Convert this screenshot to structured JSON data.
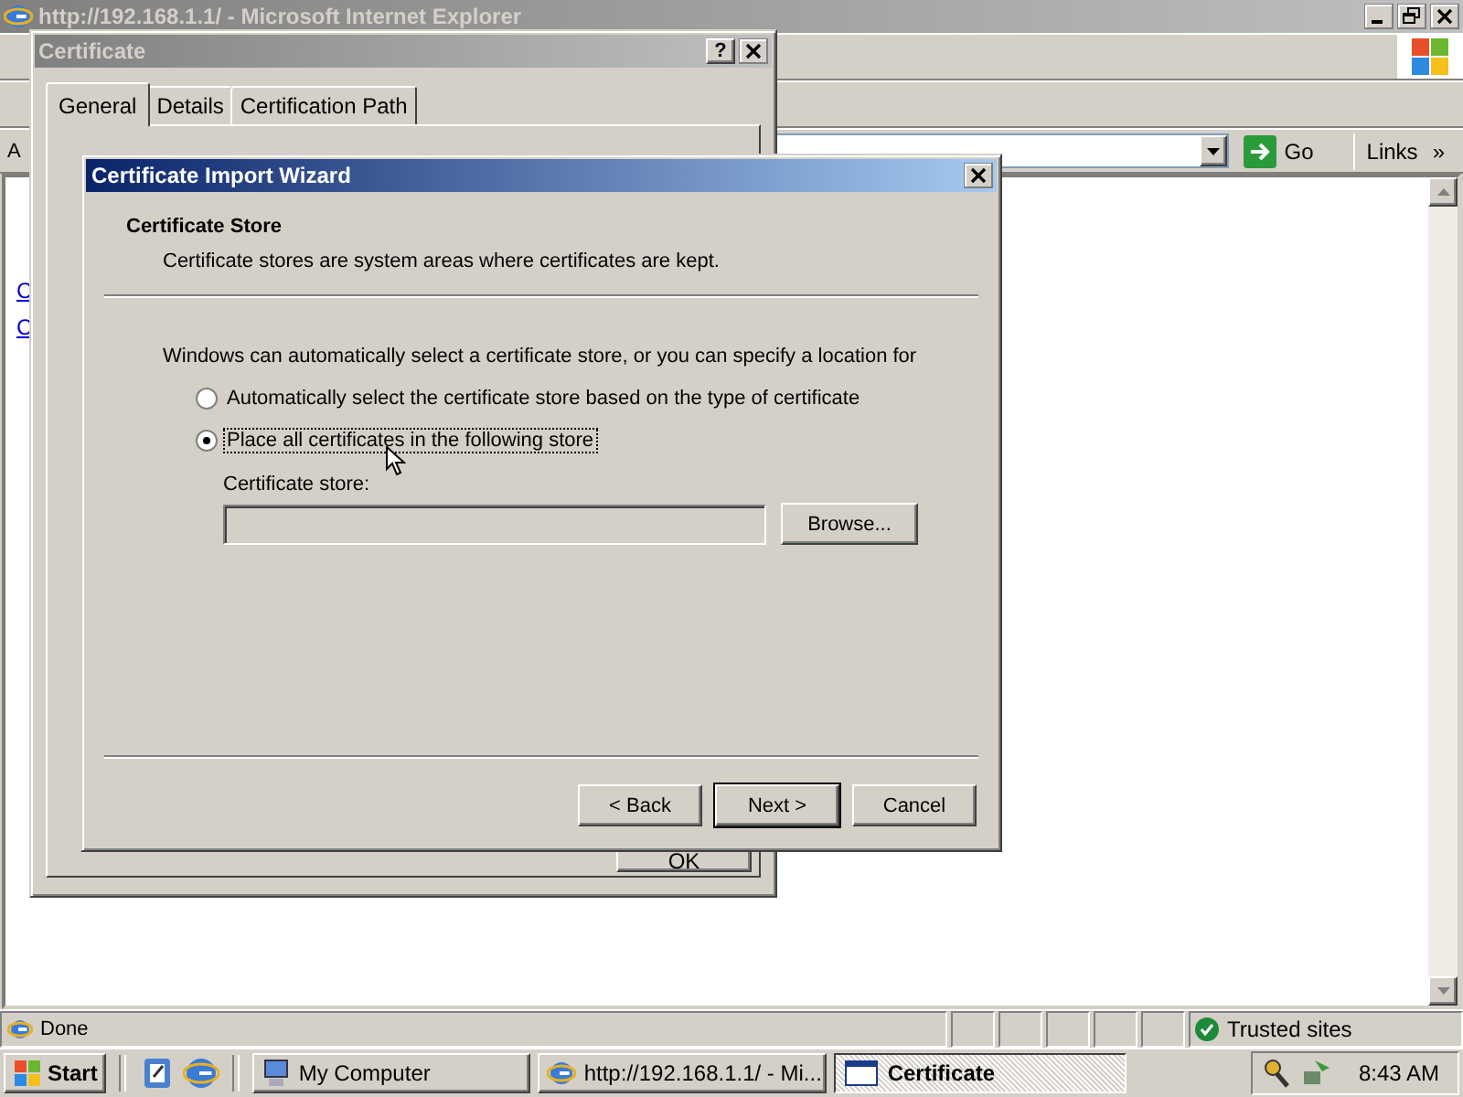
{
  "browser": {
    "title": "http://192.168.1.1/ - Microsoft Internet Explorer",
    "address_label": "A",
    "go": "Go",
    "links": "Links",
    "links_more": "»",
    "page_links": [
      "C",
      "C"
    ]
  },
  "status_bar": {
    "text": "Done",
    "zone": "Trusted sites"
  },
  "taskbar": {
    "start": "Start",
    "tasks": [
      {
        "label": "My Computer",
        "kind": "computer",
        "selected": false
      },
      {
        "label": "http://192.168.1.1/ - Mi...",
        "kind": "browser",
        "selected": false
      },
      {
        "label": "Certificate",
        "kind": "window",
        "selected": true
      }
    ],
    "clock": "8:43 AM"
  },
  "certificate_window": {
    "title": "Certificate",
    "help": "?",
    "tabs": [
      {
        "label": "General",
        "selected": true
      },
      {
        "label": "Details",
        "selected": false
      },
      {
        "label": "Certification Path",
        "selected": false
      }
    ],
    "ok": "OK"
  },
  "wizard": {
    "title": "Certificate Import Wizard",
    "heading": "Certificate Store",
    "subheading": "Certificate stores are system areas where certificates are kept.",
    "instruction": "Windows can automatically select a certificate store, or you can specify a location for",
    "options": [
      {
        "label": "Automatically select the certificate store based on the type of certificate",
        "selected": false
      },
      {
        "label": "Place all certificates in the following store",
        "selected": true
      }
    ],
    "store_label": "Certificate store:",
    "store_field": {
      "disabled": true
    },
    "browse": "Browse...",
    "buttons": [
      {
        "label": "< Back",
        "default": false
      },
      {
        "label": "Next >",
        "default": true
      },
      {
        "label": "Cancel",
        "default": false
      }
    ]
  }
}
